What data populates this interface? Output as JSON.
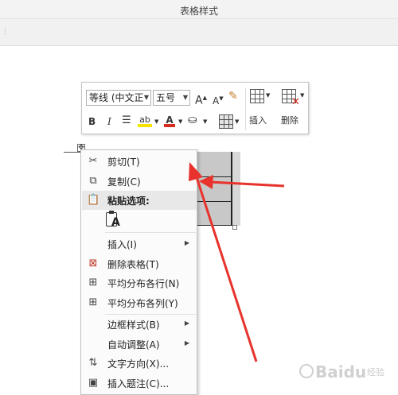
{
  "window": {
    "title": "表格样式"
  },
  "mini_toolbar": {
    "font_name": "等线 (中文正",
    "font_size": "五号",
    "grow_font": "A",
    "shrink_font": "A",
    "bold": "B",
    "italic": "I",
    "font_color_letter": "A",
    "insert_label": "插入",
    "delete_label": "删除"
  },
  "context_menu": {
    "items": [
      {
        "label": "剪切(T)",
        "icon": "scissors-icon"
      },
      {
        "label": "复制(C)",
        "icon": "copy-icon"
      },
      {
        "label": "粘贴选项:",
        "icon": "paste-icon"
      },
      {
        "label": "插入(I)",
        "icon": "",
        "submenu": true
      },
      {
        "label": "删除表格(T)",
        "icon": "delete-table-icon"
      },
      {
        "label": "平均分布各行(N)",
        "icon": "distribute-rows-icon"
      },
      {
        "label": "平均分布各列(Y)",
        "icon": "distribute-columns-icon"
      },
      {
        "label": "边框样式(B)",
        "icon": "",
        "submenu": true
      },
      {
        "label": "自动调整(A)",
        "icon": "",
        "submenu": true
      },
      {
        "label": "文字方向(X)...",
        "icon": "text-direction-icon"
      },
      {
        "label": "插入题注(C)...",
        "icon": "insert-caption-icon"
      }
    ],
    "paste_option_letter": "A"
  },
  "watermark": {
    "brand": "Baidu",
    "sub": "经验"
  },
  "colors": {
    "arrow": "#e8322b",
    "highlight_yellow": "#f5e400",
    "font_red": "#d62b1f"
  }
}
